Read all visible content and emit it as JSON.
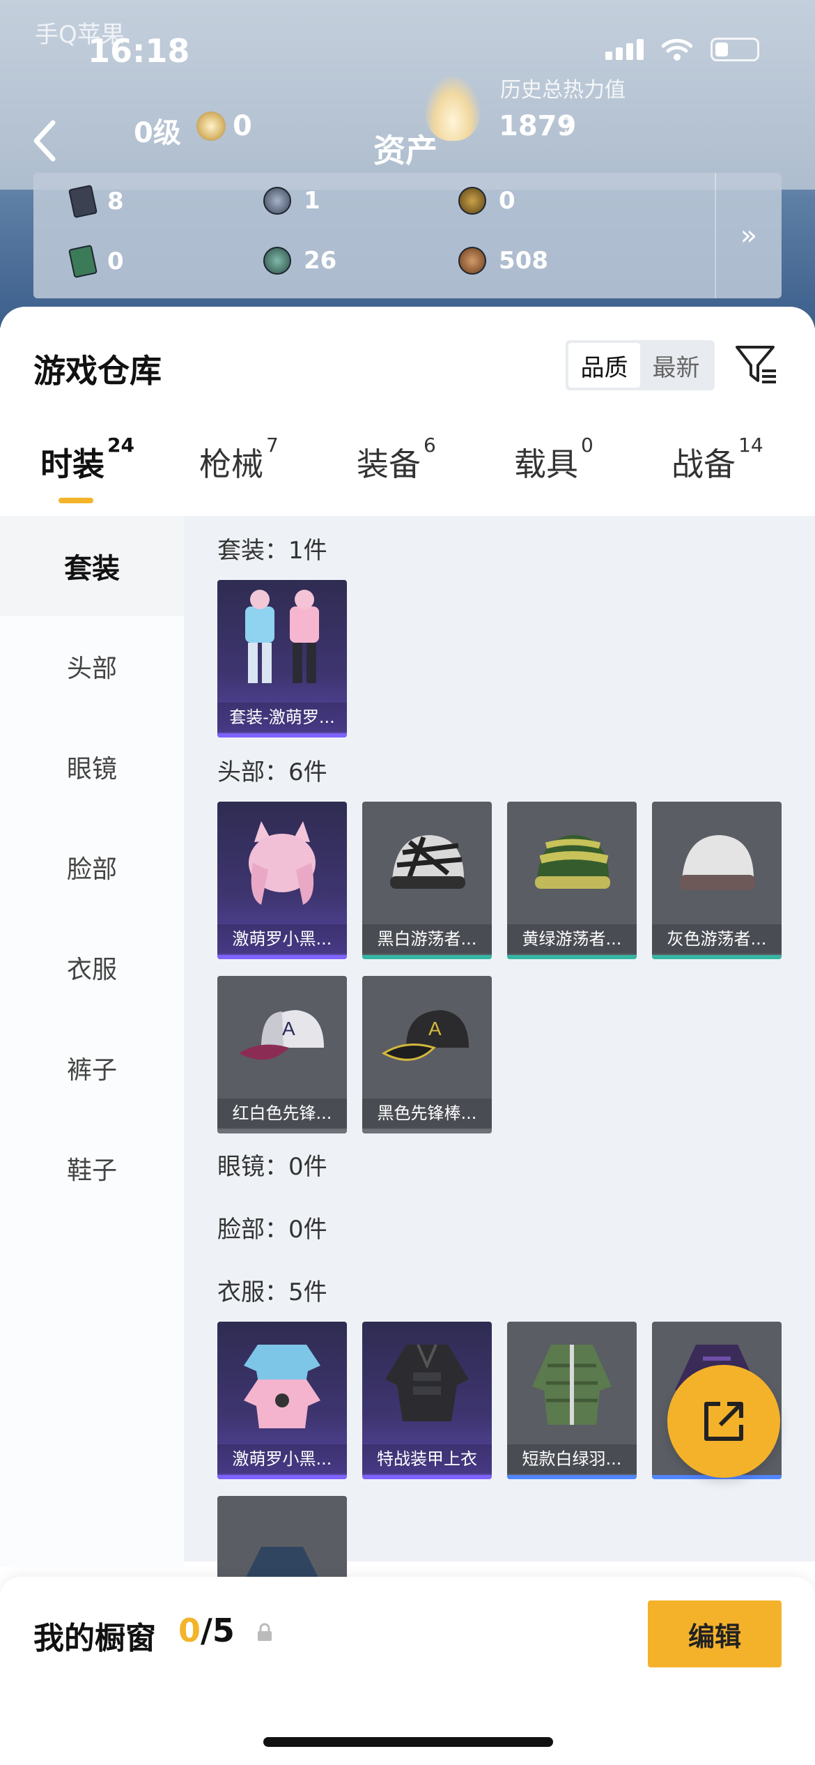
{
  "status_bar": {
    "watermark": "手Q苹果",
    "time": "16:18"
  },
  "header": {
    "title": "资产",
    "level": "0级",
    "rank_value": "0",
    "heat_label": "历史总热力值",
    "heat_value": "1879",
    "heat_help": "?"
  },
  "assets": [
    {
      "icon": "dark-card-icon",
      "value": "8"
    },
    {
      "icon": "steel-medal-icon",
      "value": "1"
    },
    {
      "icon": "gold-coin-icon",
      "value": "0"
    },
    {
      "icon": "green-card-icon",
      "value": "0"
    },
    {
      "icon": "teal-coin-icon",
      "value": "26"
    },
    {
      "icon": "bronze-coin-icon",
      "value": "508"
    }
  ],
  "assets_more": "»",
  "warehouse": {
    "title": "游戏仓库",
    "sort_options": [
      "品质",
      "最新"
    ],
    "sort_active": "品质"
  },
  "categories": [
    {
      "label": "时装",
      "count": "24"
    },
    {
      "label": "枪械",
      "count": "7"
    },
    {
      "label": "装备",
      "count": "6"
    },
    {
      "label": "载具",
      "count": "0"
    },
    {
      "label": "战备",
      "count": "14"
    }
  ],
  "sidebar": [
    "套装",
    "头部",
    "眼镜",
    "脸部",
    "衣服",
    "裤子",
    "鞋子"
  ],
  "sections": {
    "suit": {
      "label": "套装：1件",
      "items": [
        "套装-激萌罗..."
      ]
    },
    "head": {
      "label": "头部：6件",
      "items": [
        "激萌罗小黑...",
        "黑白游荡者...",
        "黄绿游荡者...",
        "灰色游荡者...",
        "红白色先锋...",
        "黑色先锋棒..."
      ]
    },
    "glasses": {
      "label": "眼镜：0件"
    },
    "face": {
      "label": "脸部：0件"
    },
    "clothes": {
      "label": "衣服：5件",
      "items": [
        "激萌罗小黑...",
        "特战装甲上衣",
        "短款白绿羽..."
      ]
    }
  },
  "showcase": {
    "label": "我的橱窗",
    "current": "0",
    "total": "/5",
    "edit_label": "编辑"
  },
  "colors": {
    "accent": "#f4b22b",
    "purple_rarity": "#7f63ff",
    "teal_rarity": "#35b6a3",
    "blue_rarity": "#5186ff"
  }
}
